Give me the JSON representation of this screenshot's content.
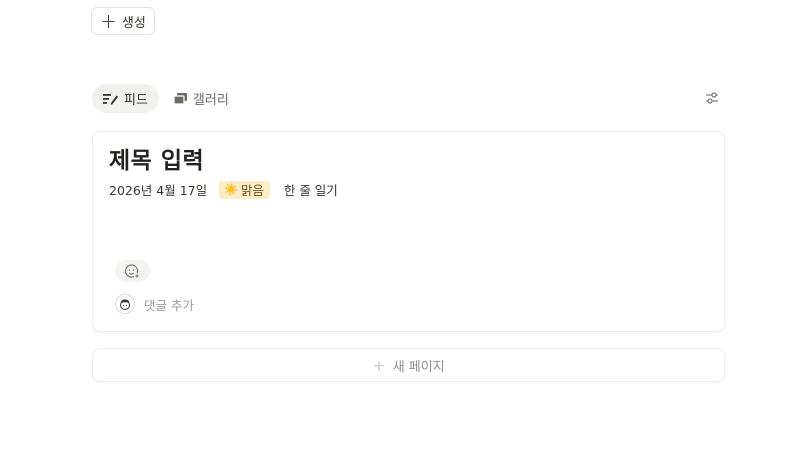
{
  "toolbar": {
    "create_icon": "plus-icon",
    "create_label": "생성"
  },
  "views": {
    "tabs": [
      {
        "label": "피드",
        "icon": "feed-icon",
        "active": true
      },
      {
        "label": "갤러리",
        "icon": "gallery-icon",
        "active": false
      }
    ],
    "settings_icon": "sliders-icon"
  },
  "entry": {
    "title": "제목 입력",
    "date": "2026년 4월 17일",
    "weather": {
      "emoji": "☀️",
      "label": "맑음",
      "bg_color": "#fbeec5"
    },
    "summary": "한 줄 일기",
    "reaction_icon": "add-reaction-icon",
    "comment_placeholder": "댓글 추가"
  },
  "new_page": {
    "label": "새 페이지"
  }
}
